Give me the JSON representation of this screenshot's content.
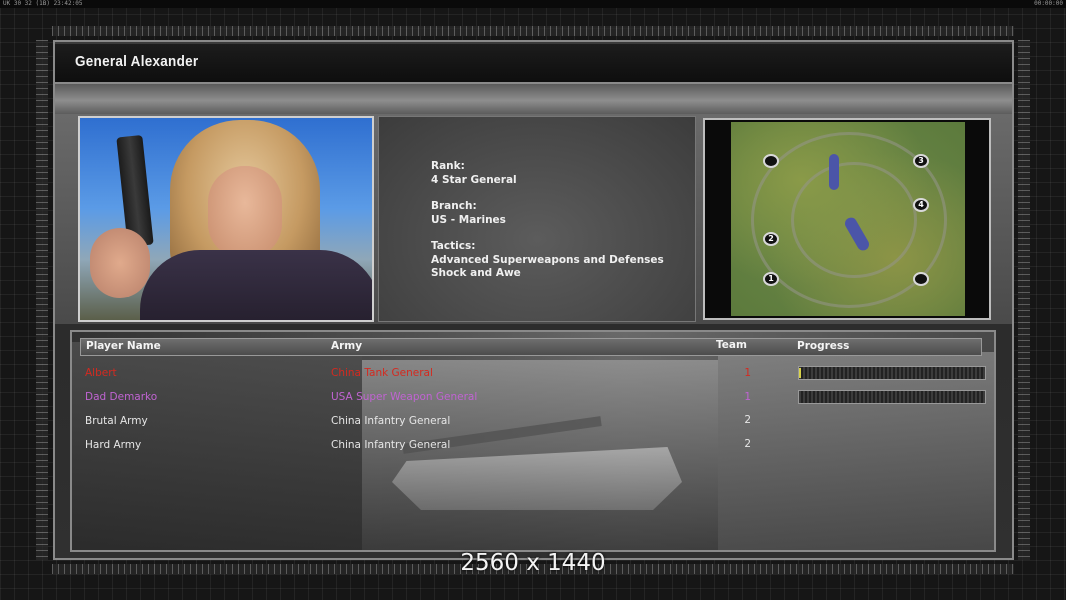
{
  "topbar": {
    "left_status": "UK 30 32 (1B) 23:42:05",
    "right_status": "00:00:00"
  },
  "header": {
    "title": "General Alexander"
  },
  "general_info": {
    "rank_label": "Rank:",
    "rank_value": "4 Star General",
    "branch_label": "Branch:",
    "branch_value": "US - Marines",
    "tactics_label": "Tactics:",
    "tactics_line1": "Advanced Superweapons and Defenses",
    "tactics_line2": "Shock and Awe"
  },
  "map": {
    "start_positions": [
      "",
      "3",
      "4",
      "2",
      "1",
      ""
    ]
  },
  "players_table": {
    "headers": {
      "player_name": "Player Name",
      "army": "Army",
      "team": "Team",
      "progress": "Progress"
    },
    "rows": [
      {
        "name": "Albert",
        "army": "China Tank General",
        "team": "1",
        "color": "#d42a20",
        "progress": 0.01
      },
      {
        "name": "Dad Demarko",
        "army": "USA Super Weapon General",
        "team": "1",
        "color": "#c064d2",
        "progress": 0.0
      },
      {
        "name": "Brutal Army",
        "army": "China Infantry General",
        "team": "2",
        "color": "#e6e6e6",
        "progress": null
      },
      {
        "name": "Hard Army",
        "army": "China Infantry General",
        "team": "2",
        "color": "#e6e6e6",
        "progress": null
      }
    ]
  },
  "resolution_caption": "2560 x 1440"
}
